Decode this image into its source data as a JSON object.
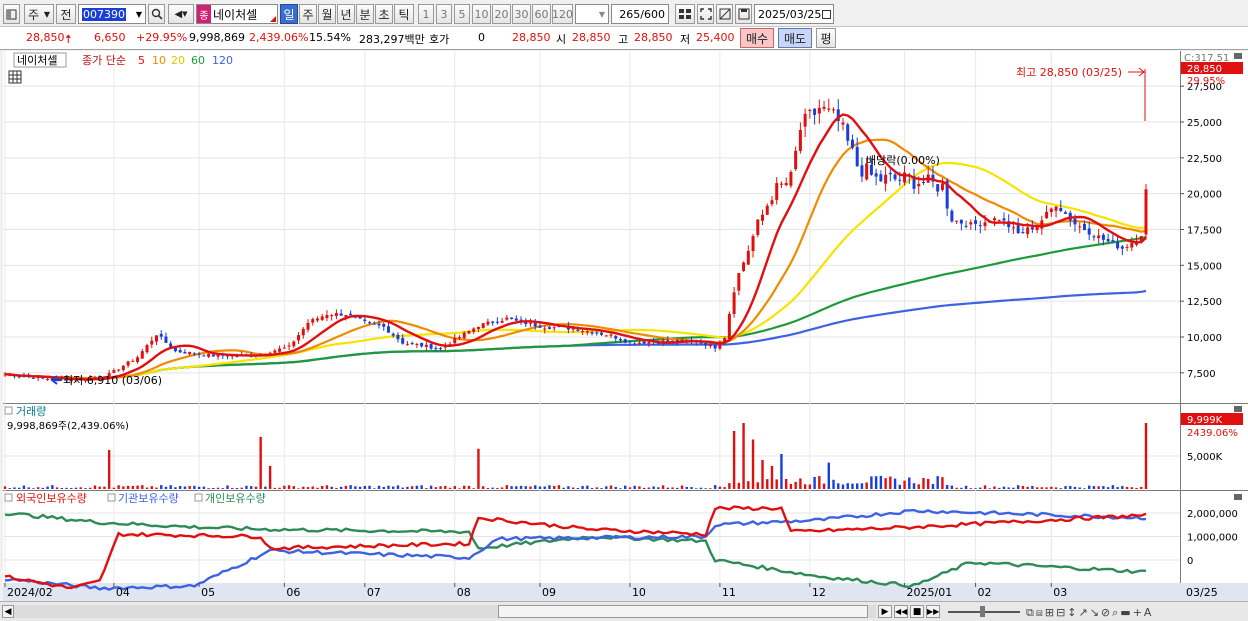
{
  "toolbar": {
    "type_label": "주",
    "jeon_label": "전",
    "code_value": "007390",
    "stock_name": "네이처셀",
    "period_tabs": [
      "일",
      "주",
      "월",
      "년",
      "분",
      "초",
      "틱"
    ],
    "active_period": "일",
    "minute_options": [
      "1",
      "3",
      "5",
      "10",
      "20",
      "30",
      "60",
      "120"
    ],
    "count_value": "265",
    "count_max": "/600",
    "date_value": "2025/03/25"
  },
  "quote": {
    "price": "28,850",
    "change": "6,650",
    "change_pct": "+29.95%",
    "volume": "9,998,869",
    "volume_ratio": "2,439.06%",
    "turnover": "15.54%",
    "amount": "283,297백만",
    "hoga_label": "호가",
    "hoga_value": "0",
    "hoga_price": "28,850",
    "open_label": "시",
    "open": "28,850",
    "high_label": "고",
    "high": "28,850",
    "low_label": "저",
    "low": "25,400",
    "buy_button": "매수",
    "sell_button": "매도",
    "eval_button": "평"
  },
  "colors": {
    "up": "#e01010",
    "down": "#1a3ed8",
    "ma5": "#e01010",
    "ma10": "#f08a00",
    "ma20": "#f4e400",
    "ma60": "#1f9a3a",
    "ma120": "#3f62e0",
    "foreign": "#e01010",
    "institution": "#3f62e0",
    "individual": "#2e8b57"
  },
  "price_panel": {
    "legend_name": "네이처셀",
    "legend_title": "종가 단순",
    "ma_periods": [
      "5",
      "10",
      "20",
      "60",
      "120"
    ],
    "max_label": "최고 28,850 (03/25)",
    "min_label": "최저 6,910 (03/06)",
    "dividend_label": "배당락(0.00%)",
    "last_price_tag": "28,850",
    "last_pct_tag": "29.95%",
    "top_scale_label": "C:317.51",
    "y_ticks": [
      "27,500",
      "25,000",
      "22,500",
      "20,000",
      "17,500",
      "15,000",
      "12,500",
      "10,000",
      "7,500"
    ]
  },
  "volume_panel": {
    "title": "거래량",
    "info": "9,998,869주(2,439.06%)",
    "tag_value": "9,999K",
    "tag_pct": "2439.06%",
    "y_ticks": [
      "5,000K"
    ]
  },
  "holding_panel": {
    "legend": [
      "외국인보유수량",
      "기관보유수량",
      "개인보유수량"
    ],
    "y_ticks": [
      "2,000,000",
      "1,000,000",
      "0"
    ]
  },
  "x_axis": {
    "labels": [
      "2024/02",
      "04",
      "05",
      "06",
      "07",
      "08",
      "09",
      "10",
      "11",
      "12",
      "2025/01",
      "02",
      "03"
    ],
    "current": "03/25"
  },
  "chart_data": {
    "type": "candlestick",
    "price_trend": [
      [
        0,
        7400
      ],
      [
        4,
        7100
      ],
      [
        8,
        7000
      ],
      [
        11,
        7400
      ],
      [
        14,
        8600
      ],
      [
        16,
        10200
      ],
      [
        18,
        9000
      ],
      [
        22,
        8700
      ],
      [
        26,
        8700
      ],
      [
        30,
        9300
      ],
      [
        32,
        11000
      ],
      [
        34,
        11600
      ],
      [
        36,
        11600
      ],
      [
        38,
        11000
      ],
      [
        40,
        10700
      ],
      [
        42,
        9600
      ],
      [
        46,
        9200
      ],
      [
        48,
        10000
      ],
      [
        50,
        10800
      ],
      [
        53,
        11300
      ],
      [
        54,
        11100
      ],
      [
        57,
        10700
      ],
      [
        60,
        10600
      ],
      [
        64,
        10100
      ],
      [
        66,
        9600
      ],
      [
        70,
        9700
      ],
      [
        73,
        9700
      ],
      [
        75,
        9300
      ],
      [
        76,
        10000
      ],
      [
        77,
        13500
      ],
      [
        79,
        17000
      ],
      [
        81,
        20000
      ],
      [
        83,
        21000
      ],
      [
        84,
        24500
      ],
      [
        86,
        26000
      ],
      [
        88,
        25000
      ],
      [
        90,
        22000
      ],
      [
        92,
        21000
      ],
      [
        95,
        21000
      ],
      [
        97,
        20800
      ],
      [
        99,
        20500
      ],
      [
        100,
        18200
      ],
      [
        102,
        17800
      ],
      [
        105,
        18300
      ],
      [
        107,
        17200
      ],
      [
        109,
        17800
      ],
      [
        111,
        19300
      ],
      [
        113,
        17900
      ],
      [
        116,
        16800
      ],
      [
        118,
        16200
      ],
      [
        119,
        16600
      ],
      [
        120,
        17200
      ],
      [
        120.5,
        20300
      ]
    ],
    "volume_days": [
      [
        11,
        5900
      ],
      [
        27,
        7900
      ],
      [
        28,
        3500
      ],
      [
        50,
        6100
      ],
      [
        77,
        8800
      ],
      [
        78,
        10000
      ],
      [
        79,
        7500
      ],
      [
        80,
        4400
      ],
      [
        81,
        3500
      ],
      [
        82,
        5300
      ],
      [
        87,
        4000
      ],
      [
        120.5,
        9999
      ]
    ],
    "holding_series": {
      "foreign": [
        [
          0,
          -700000
        ],
        [
          7,
          -1200000
        ],
        [
          10,
          -900000
        ],
        [
          12,
          1100000
        ],
        [
          27,
          1000000
        ],
        [
          28,
          500000
        ],
        [
          49,
          700000
        ],
        [
          50,
          1800000
        ],
        [
          62,
          1300000
        ],
        [
          74,
          1100000
        ],
        [
          75,
          2200000
        ],
        [
          82,
          2200000
        ],
        [
          83,
          1200000
        ],
        [
          96,
          1400000
        ],
        [
          120,
          1900000
        ]
      ],
      "institution": [
        [
          0,
          -800000
        ],
        [
          10,
          -1200000
        ],
        [
          20,
          -1100000
        ],
        [
          28,
          400000
        ],
        [
          49,
          100000
        ],
        [
          52,
          900000
        ],
        [
          74,
          1000000
        ],
        [
          75,
          1500000
        ],
        [
          86,
          1700000
        ],
        [
          96,
          2100000
        ],
        [
          120,
          1800000
        ]
      ],
      "individual": [
        [
          0,
          2000000
        ],
        [
          10,
          1600000
        ],
        [
          20,
          1400000
        ],
        [
          28,
          1300000
        ],
        [
          49,
          1200000
        ],
        [
          50,
          500000
        ],
        [
          62,
          1000000
        ],
        [
          74,
          800000
        ],
        [
          75,
          0
        ],
        [
          86,
          -700000
        ],
        [
          96,
          -1100000
        ],
        [
          102,
          -100000
        ],
        [
          120,
          -500000
        ]
      ]
    }
  }
}
